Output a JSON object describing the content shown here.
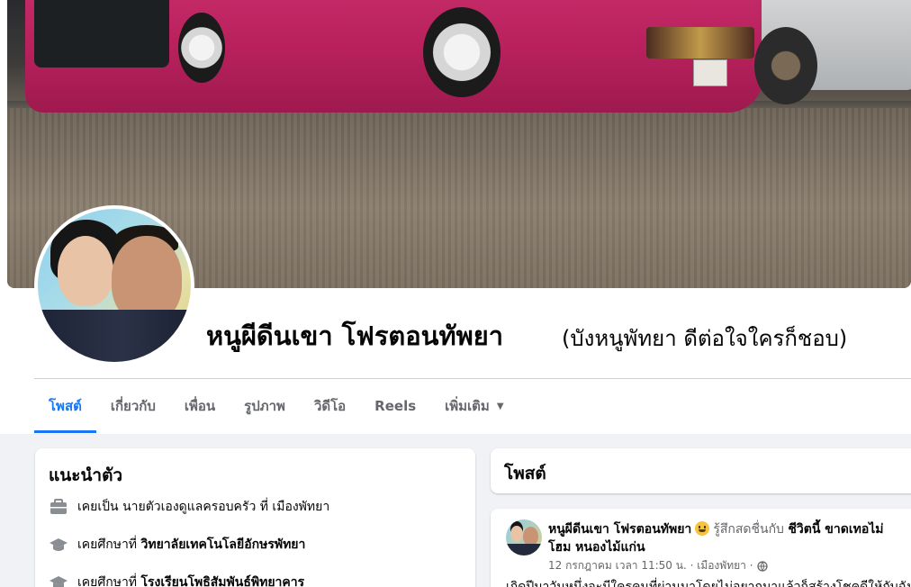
{
  "profile": {
    "name": "หนูผีดีนเขา โฟรตอนทัพยา",
    "alternate_name": "(บังหนูพัทยา ดีต่อใจใครก็ชอบ)"
  },
  "tabs": [
    {
      "label": "โพสต์",
      "active": true
    },
    {
      "label": "เกี่ยวกับ",
      "active": false
    },
    {
      "label": "เพื่อน",
      "active": false
    },
    {
      "label": "รูปภาพ",
      "active": false
    },
    {
      "label": "วิดีโอ",
      "active": false
    },
    {
      "label": "Reels",
      "active": false
    },
    {
      "label": "เพิ่มเติม",
      "active": false
    }
  ],
  "intro": {
    "title": "แนะนำตัว",
    "items": [
      {
        "icon": "briefcase-icon",
        "prefix": "เคยเป็น",
        "value": "นายตัวเองดูแลครอบครัว ที่ เมืองพัทยา"
      },
      {
        "icon": "graduation-cap-icon",
        "prefix": "เคยศึกษาที่",
        "value": "วิทยาลัยเทคโนโลยีอักษรพัทยา"
      },
      {
        "icon": "graduation-cap-icon",
        "prefix": "เคยศึกษาที่",
        "value": "โรงเรียนโพธิสัมพันธ์พิทยาคาร"
      }
    ]
  },
  "posts_section": {
    "title": "โพสต์"
  },
  "post": {
    "author": "หนูผีดีนเขา โฟรตอนทัพยา",
    "feeling_text": "รู้สึกสดชื่นกับ",
    "feeling_target": "ชีวิตนี้ ขาดเทอไม่",
    "location_line": "โฮม หนองไม้แก่น",
    "meta": "12 กรกฎาคม เวลา 11:50 น. · เมืองพัทยา ·",
    "body_preview": "เกิดปีมาวันหนึ่งจะมีใครคนที่ผ่านมาโดยไม่อยากมาแล้วก็สร้างโชคดีให้กับฉัน"
  },
  "colors": {
    "accent": "#1877f2",
    "muted_text": "#65676b",
    "page_background": "#f0f2f5"
  }
}
